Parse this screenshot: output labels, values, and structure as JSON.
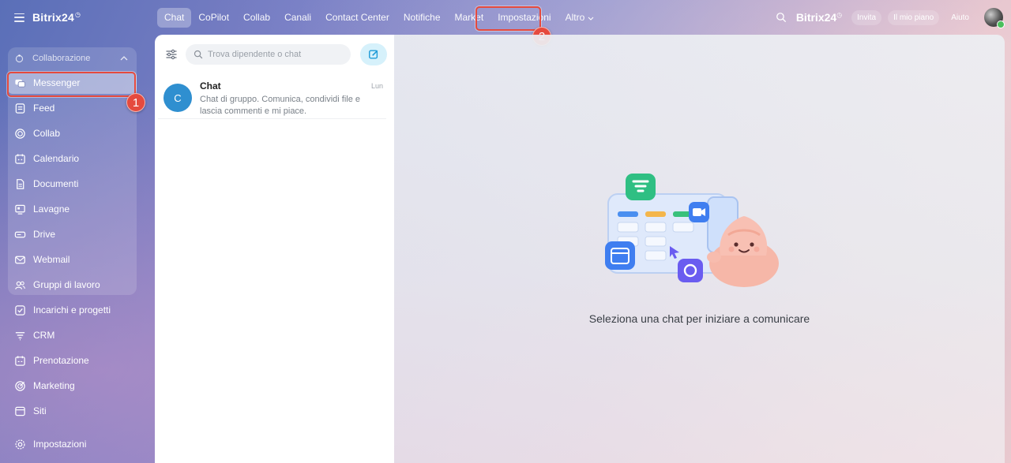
{
  "sidebar": {
    "brand": "Bitrix24",
    "group_label": "Collaborazione",
    "items": [
      {
        "label": "Messenger",
        "icon": "messenger-icon",
        "active": true
      },
      {
        "label": "Feed",
        "icon": "feed-icon"
      },
      {
        "label": "Collab",
        "icon": "collab-icon"
      },
      {
        "label": "Calendario",
        "icon": "calendar-icon"
      },
      {
        "label": "Documenti",
        "icon": "document-icon"
      },
      {
        "label": "Lavagne",
        "icon": "board-icon"
      },
      {
        "label": "Drive",
        "icon": "drive-icon"
      },
      {
        "label": "Webmail",
        "icon": "mail-icon"
      },
      {
        "label": "Gruppi di lavoro",
        "icon": "group-icon"
      },
      {
        "label": "Incarichi e progetti",
        "icon": "task-icon"
      },
      {
        "label": "CRM",
        "icon": "crm-icon"
      },
      {
        "label": "Prenotazione",
        "icon": "booking-icon"
      },
      {
        "label": "Marketing",
        "icon": "marketing-icon"
      },
      {
        "label": "Siti",
        "icon": "sites-icon"
      }
    ],
    "settings_label": "Impostazioni"
  },
  "topnav": {
    "tabs": [
      "Chat",
      "CoPilot",
      "Collab",
      "Canali",
      "Contact Center",
      "Notifiche",
      "Market",
      "Impostazioni",
      "Altro"
    ],
    "active_tab": "Chat"
  },
  "header_right": {
    "brand": "Bitrix24",
    "invite": "Invita",
    "plan": "Il mio piano",
    "help": "Aiuto"
  },
  "annotations": {
    "step1": "1",
    "step2": "2",
    "highlight_color": "#e54a3e"
  },
  "chat_panel": {
    "search_placeholder": "Trova dipendente o chat",
    "chats": [
      {
        "avatar_letter": "C",
        "title": "Chat",
        "date": "Lun",
        "preview": "Chat di gruppo. Comunica, condividi file e lascia commenti e mi piace."
      }
    ]
  },
  "main": {
    "empty_message": "Seleziona una chat per iniziare a comunicare"
  },
  "colors": {
    "accent": "#2f8fd0",
    "compose_bg": "#d6f1fb"
  }
}
